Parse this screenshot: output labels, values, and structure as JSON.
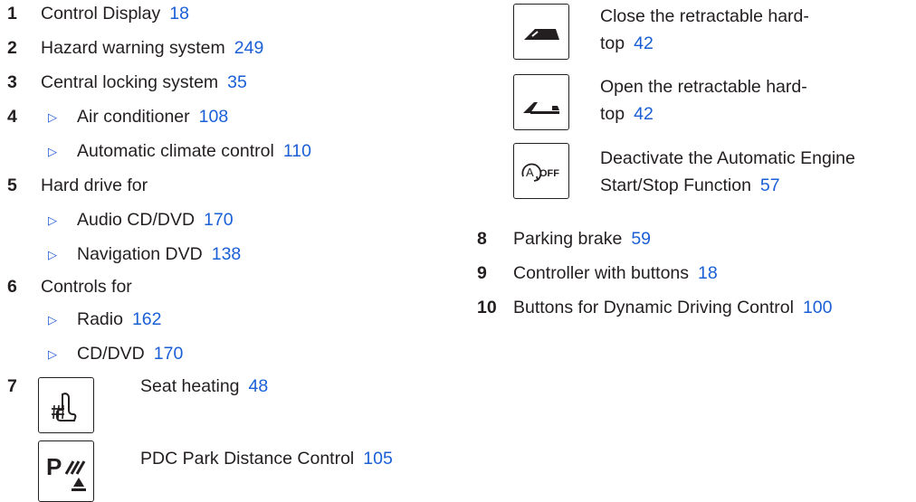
{
  "left": {
    "items": [
      {
        "num": "1",
        "label": "Control Display",
        "page": "18"
      },
      {
        "num": "2",
        "label": "Hazard warning system",
        "page": "249"
      },
      {
        "num": "3",
        "label": "Central locking system",
        "page": "35"
      },
      {
        "num": "4",
        "sub": [
          {
            "label": "Air conditioner",
            "page": "108"
          },
          {
            "label": "Automatic climate control",
            "page": "110"
          }
        ]
      },
      {
        "num": "5",
        "label": "Hard drive for",
        "sub": [
          {
            "label": "Audio CD/DVD",
            "page": "170"
          },
          {
            "label": "Navigation DVD",
            "page": "138"
          }
        ]
      },
      {
        "num": "6",
        "label": "Controls for",
        "sub": [
          {
            "label": "Radio",
            "page": "162"
          },
          {
            "label": "CD/DVD",
            "page": "170"
          }
        ]
      },
      {
        "num": "7",
        "icons": [
          {
            "icon": "seat-heating-icon",
            "label": "Seat heating",
            "page": "48"
          },
          {
            "icon": "pdc-park-distance-icon",
            "label": "PDC Park Distance Control",
            "page": "105"
          }
        ]
      }
    ]
  },
  "right": {
    "icons": [
      {
        "icon": "close-hardtop-icon",
        "line1": "Close the retractable hard-",
        "line2": "top",
        "page": "42"
      },
      {
        "icon": "open-hardtop-icon",
        "line1": "Open the retractable hard-",
        "line2": "top",
        "page": "42"
      },
      {
        "icon": "auto-start-stop-off-icon",
        "line1": "Deactivate the Automatic Engine",
        "line2": "Start/Stop Function",
        "page": "57",
        "icon_text": "OFF",
        "icon_letter": "A"
      }
    ],
    "items": [
      {
        "num": "8",
        "label": "Parking brake",
        "page": "59"
      },
      {
        "num": "9",
        "label": "Controller with buttons",
        "page": "18"
      },
      {
        "num": "10",
        "label": "Buttons for Dynamic Driving Control",
        "page": "100"
      }
    ]
  },
  "bullet_glyph": "▷",
  "colors": {
    "link": "#1a5fd6",
    "text": "#231f20"
  }
}
